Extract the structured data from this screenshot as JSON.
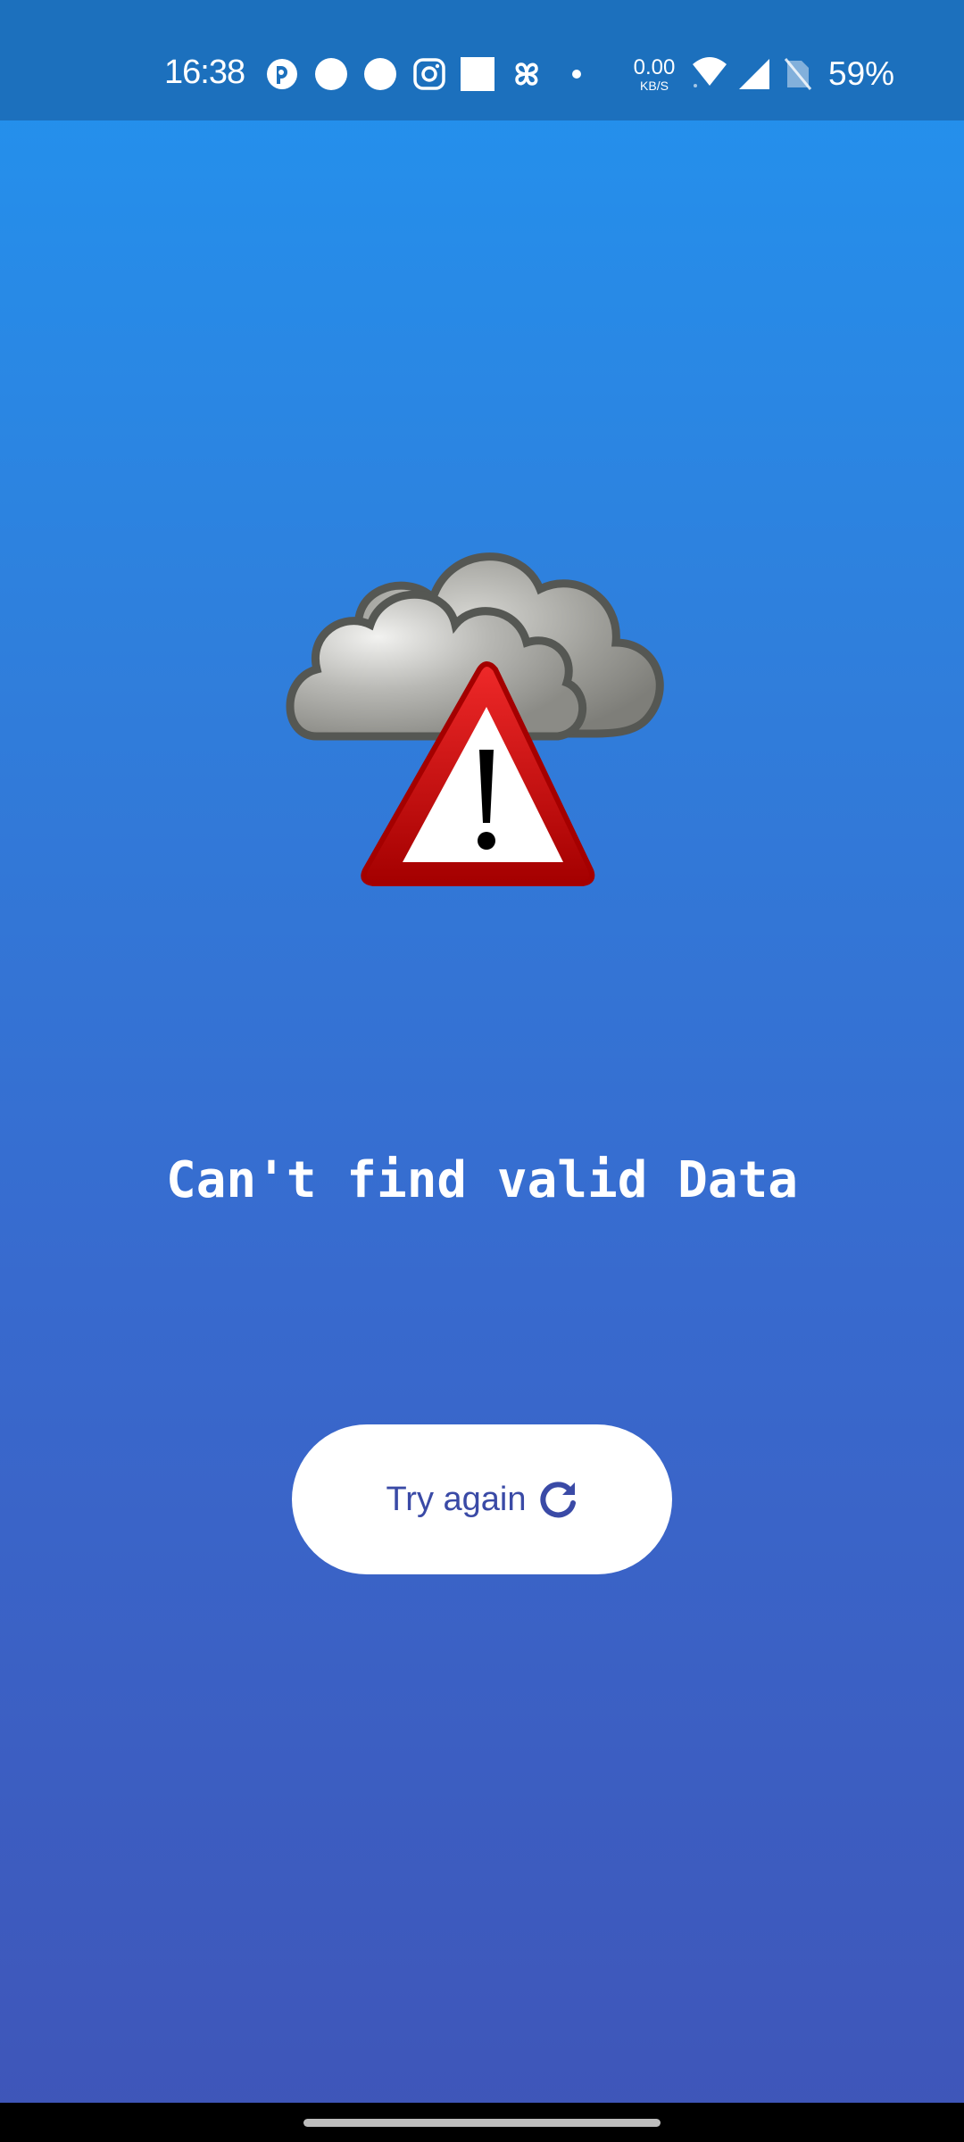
{
  "status_bar": {
    "time": "16:38",
    "net_speed_value": "0.00",
    "net_speed_unit": "KB/S",
    "battery": "59%",
    "icons": [
      "app-notification-icon",
      "circle-notification-icon",
      "circle-notification-icon",
      "instagram-icon",
      "square-notification-icon",
      "fan-icon",
      "dot-icon",
      "wifi-icon",
      "cell-signal-icon",
      "no-sim-icon"
    ]
  },
  "main": {
    "illustration_icon": "weather-warning-icon",
    "message": "Can't find valid Data",
    "button_label": "Try again",
    "button_icon": "refresh-icon"
  },
  "colors": {
    "status_bar_bg": "#1c70bd",
    "gradient_top": "#2293ef",
    "gradient_bottom": "#3f55b8",
    "button_text": "#3a4aa6",
    "warning_red": "#cc0000"
  }
}
